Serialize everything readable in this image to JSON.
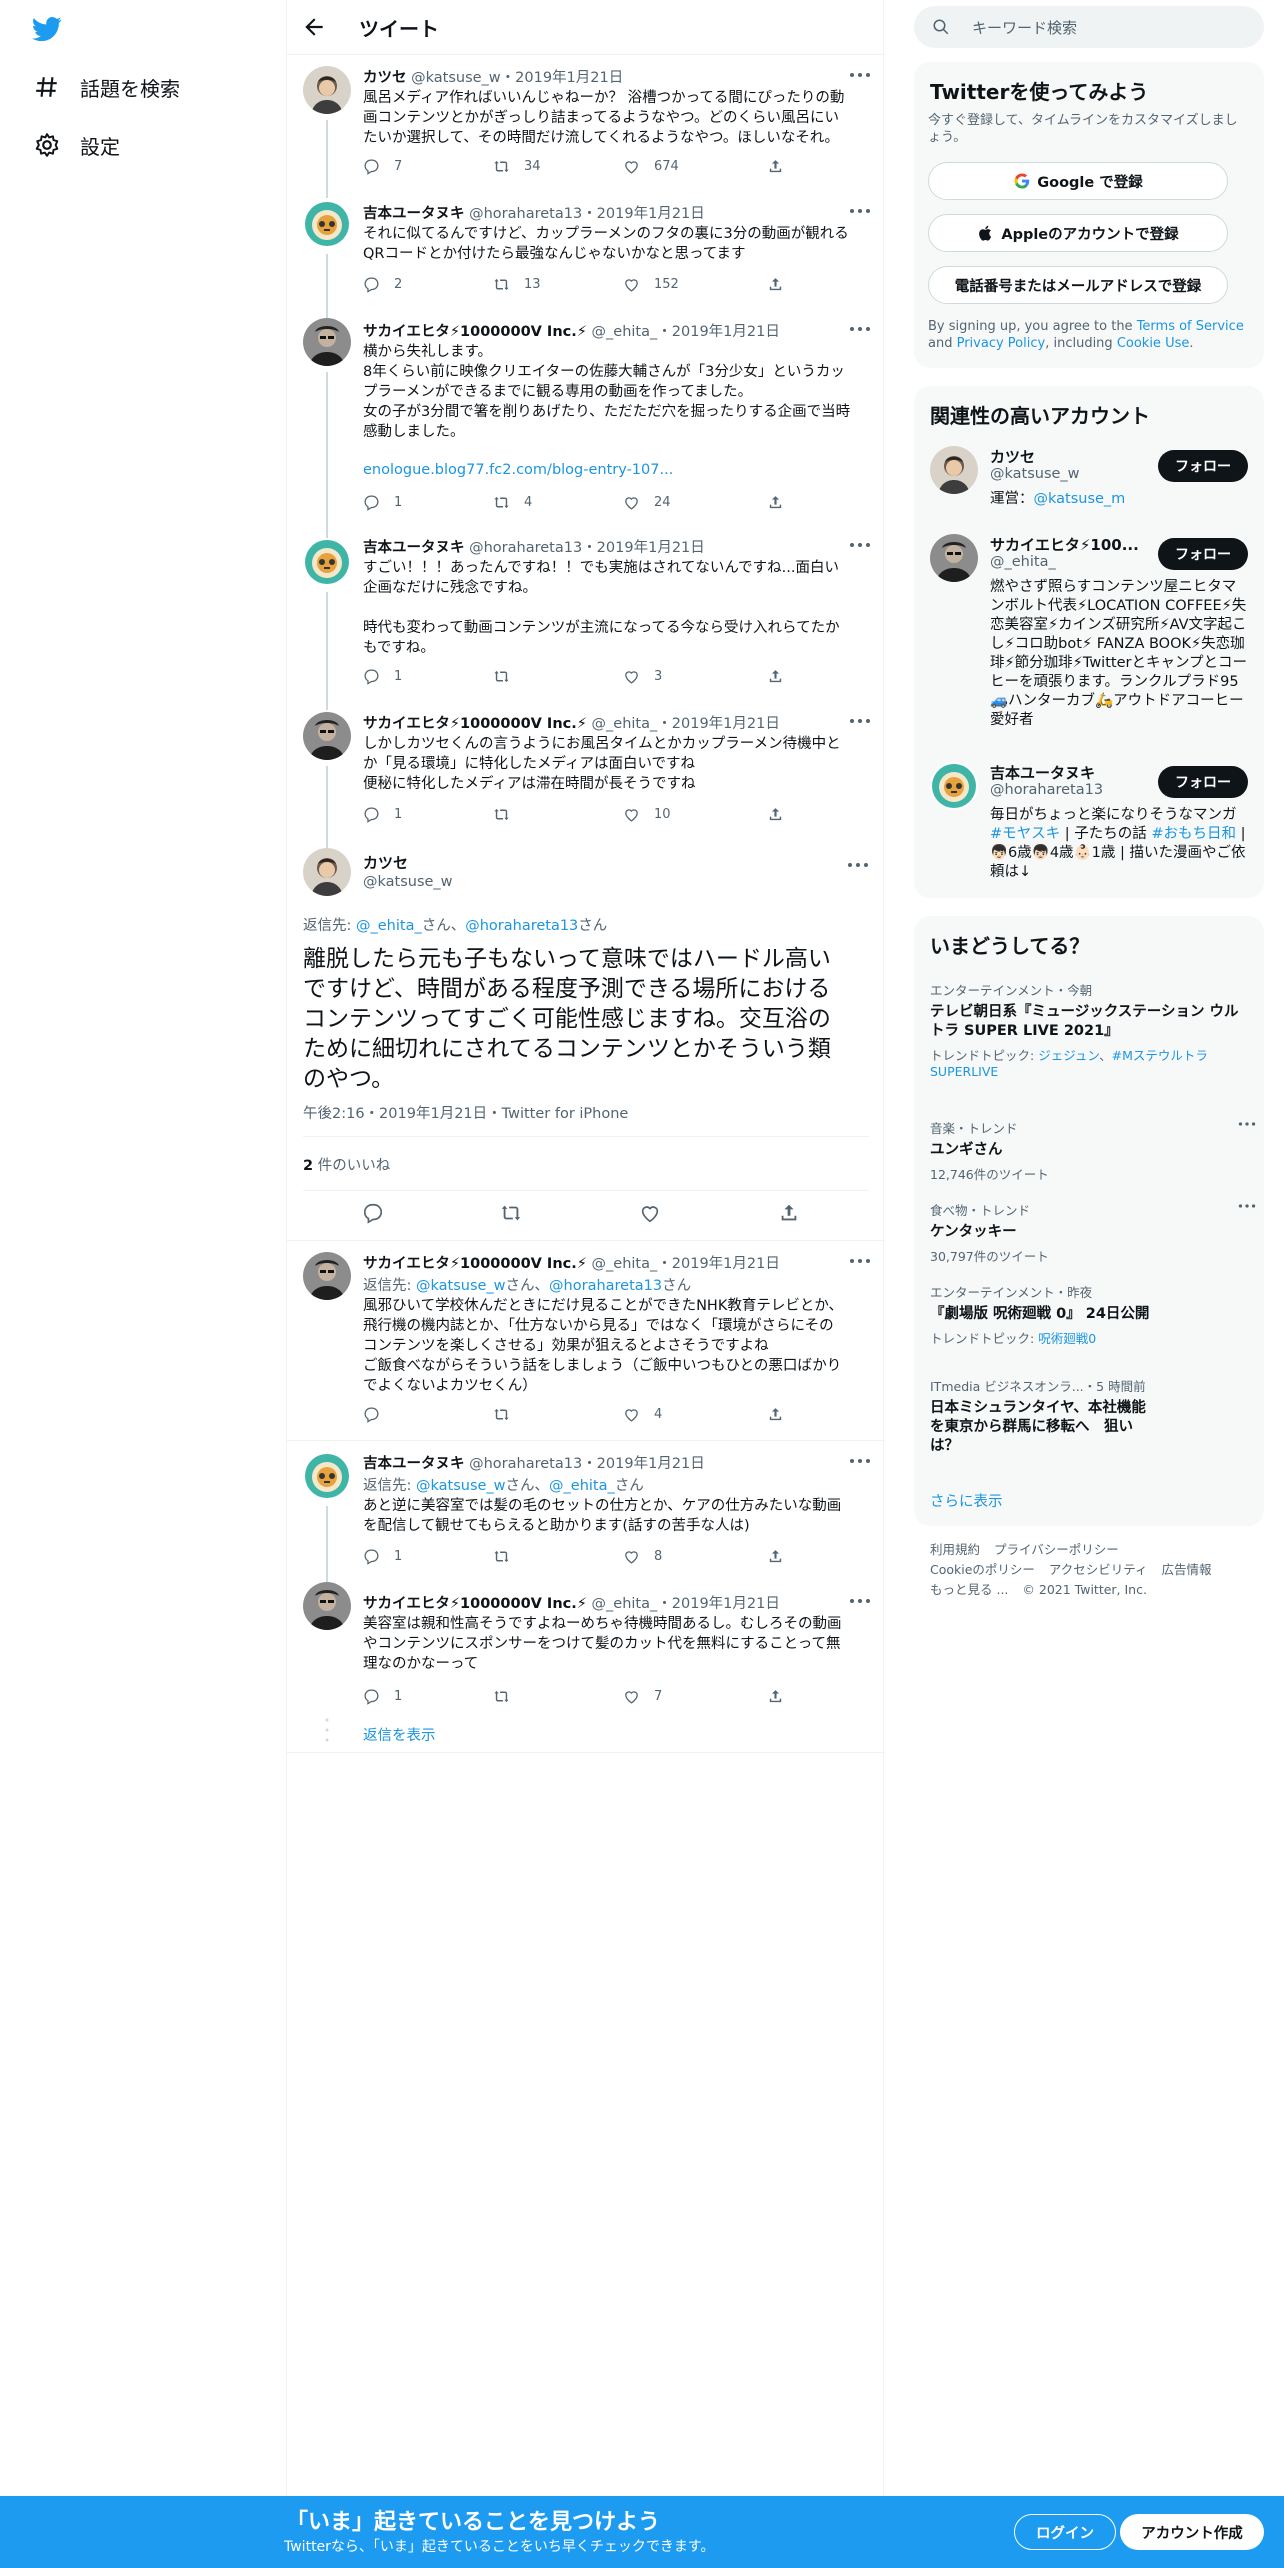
{
  "nav": {
    "explore": "話題を検索",
    "settings": "設定"
  },
  "header": {
    "title": "ツイート"
  },
  "tweets": [
    {
      "name": "カツセ",
      "handle": "@katsuse_w",
      "date": "・2019年1月21日",
      "text": "風呂メディア作ればいいんじゃねーか？ 浴槽つかってる間にぴったりの動\n画コンテンツとかがぎっしり詰まってるようなやつ。どのくらい風呂にい\nたいか選択して、その時間だけ流してくれるようなやつ。ほしいなそれ。",
      "replies": "7",
      "retweets": "34",
      "likes": "674"
    },
    {
      "name": "吉本ユータヌキ",
      "handle": "@horahareta13",
      "date": "・2019年1月21日",
      "text": "それに似てるんですけど、カップラーメンのフタの裏に3分の動画が観れる\nQRコードとか付けたら最強なんじゃないかなと思ってます",
      "replies": "2",
      "retweets": "13",
      "likes": "152"
    },
    {
      "name": "サカイエヒタ⚡1000000V Inc.⚡",
      "handle": "@_ehita_",
      "date": "・2019年1月21日",
      "text": "横から失礼します。\n8年くらい前に映像クリエイターの佐藤大輔さんが「3分少女」というカッ\nプラーメンができるまでに観る専用の動画を作ってました。\n女の子が3分間で箸を削りあげたり、ただただ穴を掘ったりする企画で当時\n感動しました。",
      "link": "enologue.blog77.fc2.com/blog-entry-107...",
      "replies": "1",
      "retweets": "4",
      "likes": "24"
    },
    {
      "name": "吉本ユータヌキ",
      "handle": "@horahareta13",
      "date": "・2019年1月21日",
      "text": "すごい！！！あったんですね！！でも実施はされてないんですね...面白い\n企画なだけに残念ですね。\n\n時代も変わって動画コンテンツが主流になってる今なら受け入れらてたか\nもですね。",
      "replies": "1",
      "retweets": "",
      "likes": "3"
    },
    {
      "name": "サカイエヒタ⚡1000000V Inc.⚡",
      "handle": "@_ehita_",
      "date": "・2019年1月21日",
      "text": "しかしカツセくんの言うようにお風呂タイムとかカップラーメン待機中と\nか「見る環境」に特化したメディアは面白いですね\n便秘に特化したメディアは滞在時間が長そうですね",
      "replies": "1",
      "retweets": "",
      "likes": "10"
    }
  ],
  "main": {
    "name": "カツセ",
    "handle": "@katsuse_w",
    "reply_prefix": "返信先: ",
    "reply_to_1": "@_ehita_",
    "reply_mid": "さん、",
    "reply_to_2": "@horahareta13",
    "reply_suffix": "さん",
    "text": "離脱したら元も子もないって意味ではハードル高い\nですけど、時間がある程度予測できる場所における\nコンテンツってすごく可能性感じますね。交互浴の\nために細切れにされてるコンテンツとかそういう類\nのやつ。",
    "meta": "午後2:16・2019年1月21日・Twitter for iPhone",
    "likes_count": "2",
    "likes_label": " 件のいいね"
  },
  "replies": [
    {
      "name": "サカイエヒタ⚡1000000V Inc.⚡",
      "handle": "@_ehita_",
      "date": "・2019年1月21日",
      "reply_prefix": "返信先: ",
      "reply_to_1": "@katsuse_w",
      "reply_mid": "さん、",
      "reply_to_2": "@horahareta13",
      "reply_suffix": "さん",
      "text": "風邪ひいて学校休んだときにだけ見ることができたNHK教育テレビとか、\n飛行機の機内誌とか、「仕方ないから見る」ではなく「環境がさらにその\nコンテンツを楽しくさせる」効果が狙えるとよさそうですよね\nご飯食べながらそういう話をしましょう（ご飯中いつもひとの悪口ばかり\nでよくないよカツセくん）",
      "replies": "",
      "retweets": "",
      "likes": "4"
    },
    {
      "name": "吉本ユータヌキ",
      "handle": "@horahareta13",
      "date": "・2019年1月21日",
      "reply_prefix": "返信先: ",
      "reply_to_1": "@katsuse_w",
      "reply_mid": "さん、",
      "reply_to_2": "@_ehita_",
      "reply_suffix": "さん",
      "text": "あと逆に美容室では髪の毛のセットの仕方とか、ケアの仕方みたいな動画\nを配信して観せてもらえると助かります(話すの苦手な人は)",
      "replies": "1",
      "retweets": "",
      "likes": "8"
    },
    {
      "name": "サカイエヒタ⚡1000000V Inc.⚡",
      "handle": "@_ehita_",
      "date": "・2019年1月21日",
      "text": "美容室は親和性高そうですよねーめちゃ待機時間あるし。むしろその動画\nやコンテンツにスポンサーをつけて髪のカット代を無料にすることって無\n理なのかなーって",
      "replies": "1",
      "retweets": "",
      "likes": "7"
    }
  ],
  "show_replies": "返信を表示",
  "search": {
    "placeholder": "キーワード検索"
  },
  "signup": {
    "title": "Twitterを使ってみよう",
    "sub": "今すぐ登録して、タイムラインをカスタマイズしましょう。",
    "google": "Google で登録",
    "apple": "Appleのアカウントで登録",
    "phone": "電話番号またはメールアドレスで登録",
    "tos_1": "By signing up, you agree to the ",
    "tos_terms": "Terms of Service",
    "tos_2": " and ",
    "tos_privacy": "Privacy Policy",
    "tos_3": ", including ",
    "tos_cookie": "Cookie Use",
    "tos_4": "."
  },
  "related": {
    "title": "関連性の高いアカウント",
    "follow": "フォロー",
    "accounts": [
      {
        "name": "カツセ",
        "handle": "@katsuse_w",
        "bio_1": "運営：",
        "bio_link": "@katsuse_m"
      },
      {
        "name": "サカイエヒタ⚡100...",
        "handle": "@_ehita_",
        "bio": "燃やさず照らすコンテンツ屋ニヒタマンボルト代表⚡LOCATION COFFEE⚡失恋美容室⚡カインズ研究所⚡AV文字起こし⚡コロ助bot⚡ FANZA BOOK⚡失恋珈琲⚡節分珈琲⚡Twitterとキャンプとコーヒーを頑張ります。ランクルプラド95🚙ハンターカブ🛵アウトドアコーヒー愛好者"
      },
      {
        "name": "吉本ユータヌキ",
        "handle": "@horahareta13",
        "bio_1": "毎日がちょっと楽になりそうなマンガ ",
        "bio_tag1": "#モヤスキ",
        "bio_2": " | 子たちの話 ",
        "bio_tag2": "#おもち日和",
        "bio_3": " | 👦🏻6歳👦🏻4歳👶🏻1歳 | 描いた漫画やご依頼は↓"
      }
    ]
  },
  "trends": {
    "title": "いまどうしてる？",
    "items": [
      {
        "category": "エンターテインメント・今朝",
        "title": "テレビ朝日系『ミュージックステーション ウルトラ SUPER LIVE 2021』",
        "topic_label": "トレンドトピック: ",
        "topic_1": "ジェジュン",
        "topic_sep": "、",
        "topic_2": "#Mステウルトラ SUPERLIVE"
      },
      {
        "category": "音楽・トレンド",
        "title": "ユンギさん",
        "count": "12,746件のツイート"
      },
      {
        "category": "食べ物・トレンド",
        "title": "ケンタッキー",
        "count": "30,797件のツイート"
      },
      {
        "category": "エンターテインメント・昨夜",
        "title": "『劇場版 呪術廻戦 0』 24日公開",
        "topic_label": "トレンドトピック: ",
        "topic_1": "呪術廻戦0"
      },
      {
        "category": "ITmedia ビジネスオンラ...・5 時間前",
        "title": "日本ミシュランタイヤ、本社機能を東京から群馬に移転へ　狙いは？"
      }
    ],
    "more": "さらに表示"
  },
  "footer": {
    "links": [
      "利用規約",
      "プライバシーポリシー",
      "Cookieのポリシー",
      "アクセシビリティ",
      "広告情報",
      "もっと見る ...",
      "© 2021 Twitter, Inc."
    ]
  },
  "bottom": {
    "title": "「いま」起きていることを見つけよう",
    "sub": "Twitterなら、「いま」起きていることをいち早くチェックできます。",
    "login": "ログイン",
    "signup": "アカウント作成"
  },
  "colors": {
    "accent": "#1d9bf0",
    "link": "#1b95e0",
    "text": "#0f1419",
    "muted": "#536471"
  }
}
